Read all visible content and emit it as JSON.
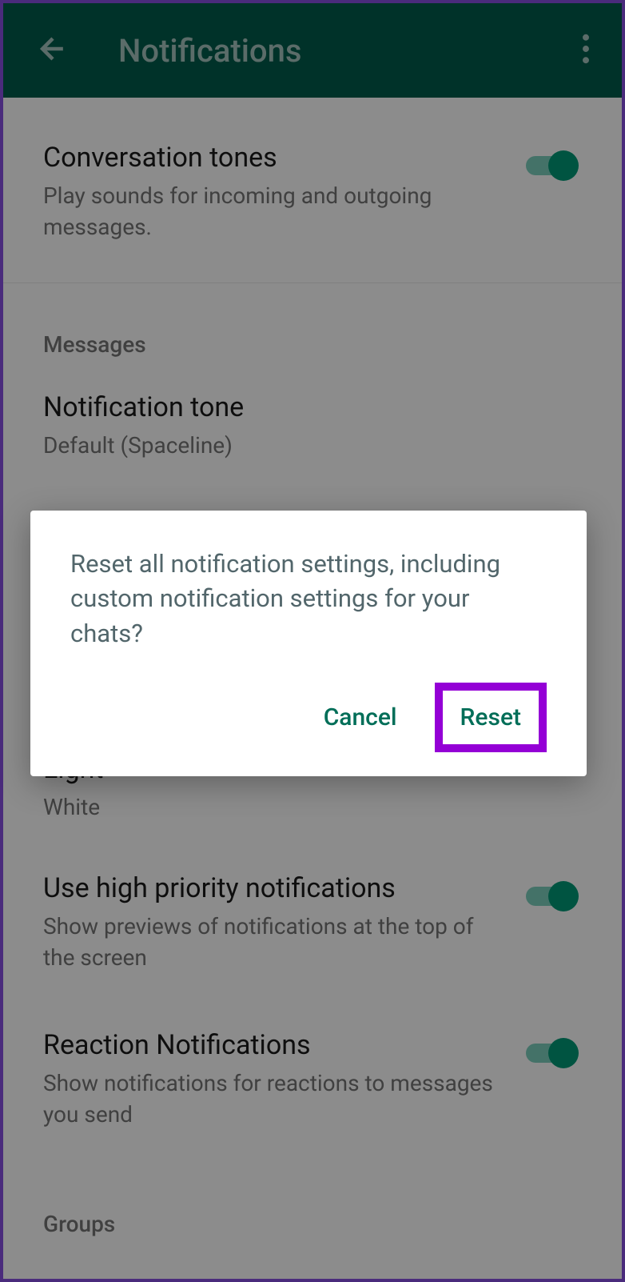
{
  "header": {
    "title": "Notifications"
  },
  "conversation_tones": {
    "title": "Conversation tones",
    "subtitle": "Play sounds for incoming and outgoing messages."
  },
  "sections": {
    "messages": "Messages",
    "groups": "Groups"
  },
  "notification_tone": {
    "title": "Notification tone",
    "value": "Default (Spaceline)"
  },
  "light": {
    "title": "Light",
    "value": "White"
  },
  "high_priority": {
    "title": "Use high priority notifications",
    "subtitle": "Show previews of notifications at the top of the screen"
  },
  "reactions": {
    "title": "Reaction Notifications",
    "subtitle": "Show notifications for reactions to messages you send"
  },
  "dialog": {
    "message": "Reset all notification settings, including custom notification settings for your chats?",
    "cancel": "Cancel",
    "reset": "Reset"
  }
}
